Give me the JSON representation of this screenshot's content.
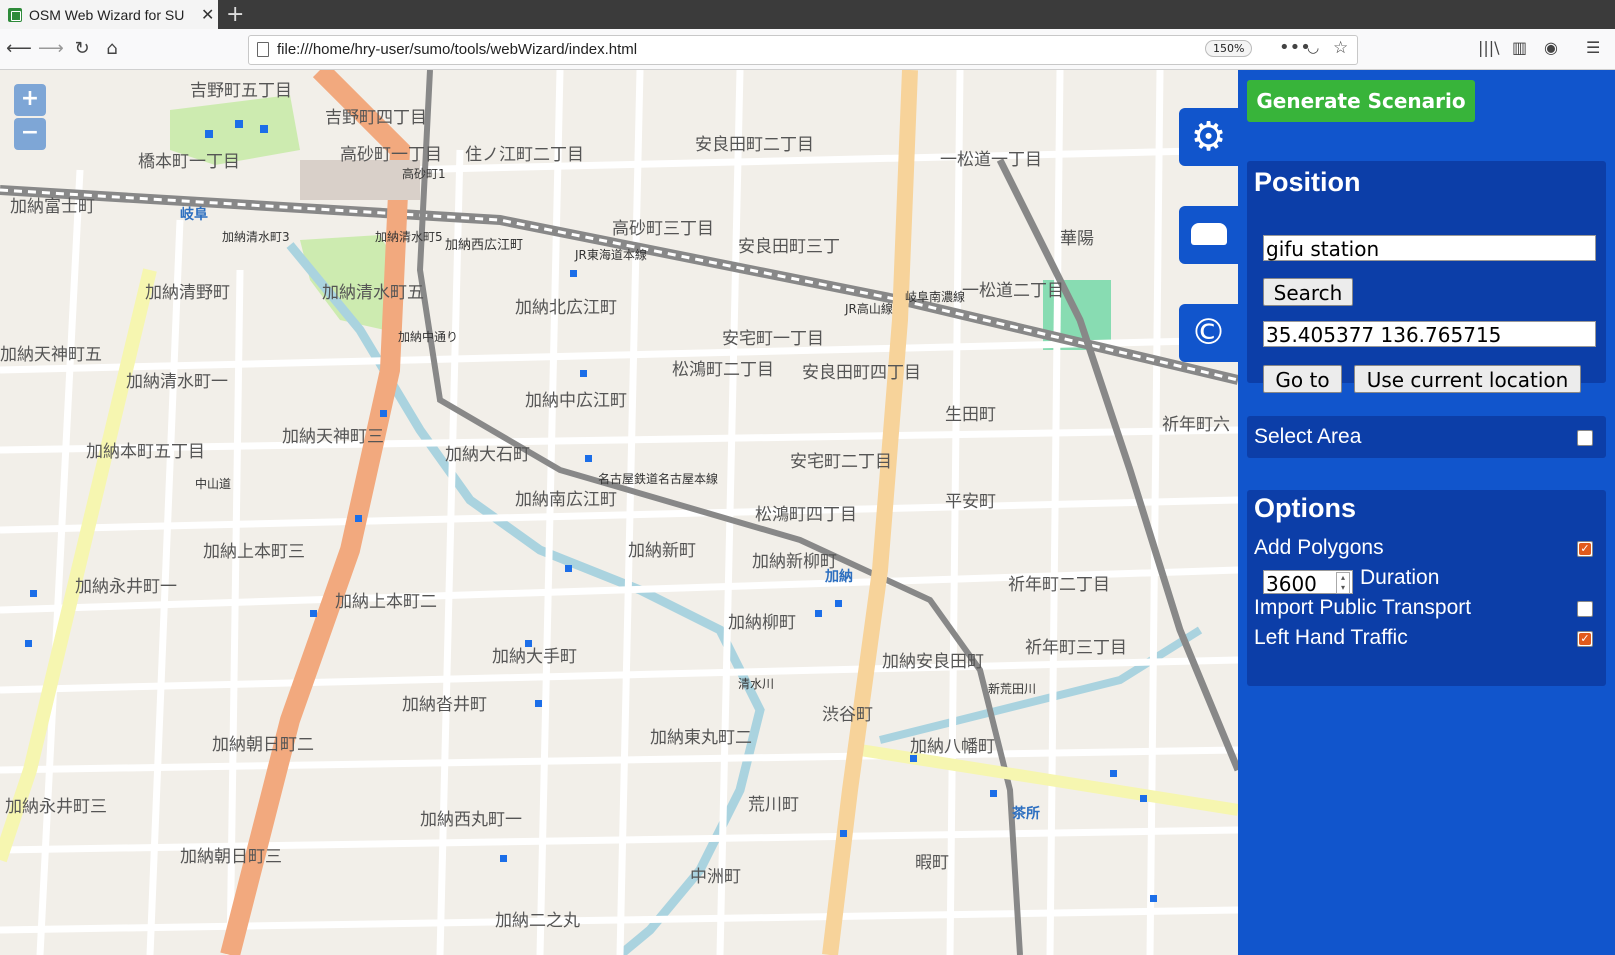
{
  "browser": {
    "tab_title": "OSM Web Wizard for SU",
    "close_glyph": "✕",
    "newtab_glyph": "+",
    "url": "file:///home/hry-user/sumo/tools/webWizard/index.html",
    "zoom": "150%",
    "more_glyph": "•••"
  },
  "map": {
    "zoom_in": "+",
    "zoom_out": "−",
    "labels": [
      "吉野町五丁目",
      "吉野町四丁目",
      "橋本町一丁目",
      "高砂町一丁目",
      "住ノ江町二丁目",
      "安良田町二丁目",
      "一松道一丁目",
      "加納富士町",
      "加納清野町",
      "加納清水町五",
      "加納北広江町",
      "安宅町一丁目",
      "松鴻町二丁目",
      "安良田町四丁目",
      "加納中広江町",
      "生田町",
      "加納大石町",
      "加納南広江町",
      "安宅町二丁目",
      "平安町",
      "加納天神町三",
      "加納本町五丁目",
      "加納上本町三",
      "加納新町",
      "加納新柳町",
      "祈年町二丁目",
      "加納永井町一",
      "加納上本町二",
      "加納柳町",
      "祈年町三丁目",
      "加納大手町",
      "加納安良田町",
      "加納沓井町",
      "渋谷町",
      "加納八幡町",
      "加納東丸町二",
      "加納朝日町二",
      "荒川町",
      "加納永井町三",
      "加納西丸町一",
      "中洲町",
      "暇町",
      "加納朝日町三",
      "加納二之丸",
      "高砂町三丁目",
      "安良田町三丁",
      "一松道二丁目",
      "華陽",
      "加納天神町五",
      "加納清水町一",
      "加納西広江町",
      "松鴻町四丁目",
      "祈年町六"
    ],
    "station_labels": [
      "岐阜",
      "加納",
      "茶所"
    ],
    "road_labels": [
      "中山道",
      "名古屋鉄道名古屋本線",
      "JR東海道本線",
      "岐阜南濃線",
      "加納中通り",
      "新荒田川",
      "清水川",
      "JR高山線",
      "加納清水町3",
      "加納清水町5",
      "高砂町1"
    ]
  },
  "side_tabs": {
    "settings_icon": "⚙",
    "vehicle_icon": "🚗",
    "copyright_icon": "©"
  },
  "panel": {
    "generate_label": "Generate Scenario",
    "position": {
      "title": "Position",
      "search_value": "gifu station",
      "search_button": "Search",
      "coords_value": "35.405377 136.765715",
      "goto_button": "Go to",
      "current_location_button": "Use current location"
    },
    "select_area": {
      "label": "Select Area",
      "checked": false
    },
    "options": {
      "title": "Options",
      "add_polygons": {
        "label": "Add Polygons",
        "checked": true
      },
      "duration": {
        "value": "3600",
        "label": "Duration"
      },
      "public_transport": {
        "label": "Import Public Transport",
        "checked": false
      },
      "left_hand": {
        "label": "Left Hand Traffic",
        "checked": true
      }
    }
  },
  "colors": {
    "panel_bg": "#1155cc",
    "box_bg": "#0c3ea8",
    "generate_bg": "#38b43a",
    "map_bg": "#f2efe9",
    "major_road": "#f2a97e",
    "secondary_road": "#f7d39a",
    "tertiary_road": "#f6f6b0",
    "water": "#aad3df",
    "checkbox_on": "#e25a1c"
  }
}
